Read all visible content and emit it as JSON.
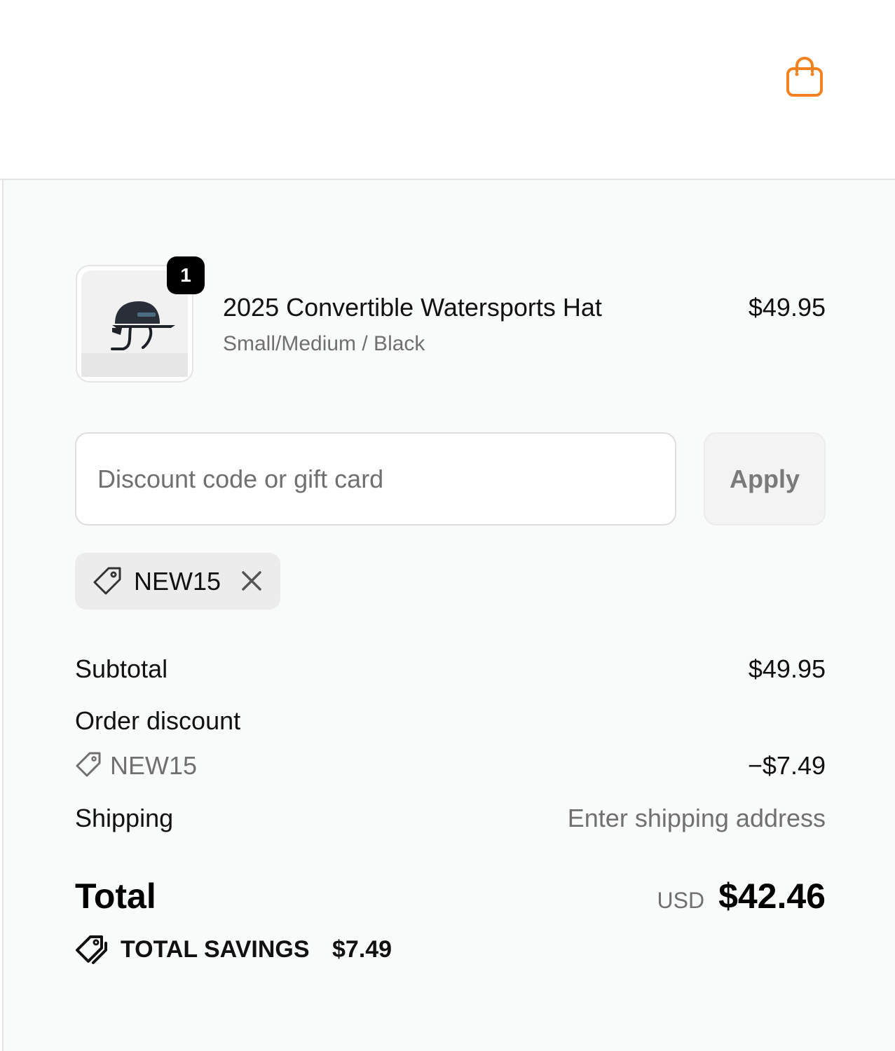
{
  "header": {
    "cart_icon": "shopping-bag-icon",
    "accent_color": "#f48120"
  },
  "product": {
    "image_alt": "hat-image",
    "quantity": "1",
    "name": "2025 Convertible Watersports Hat",
    "variant": "Small/Medium / Black",
    "price": "$49.95"
  },
  "discount": {
    "placeholder": "Discount code or gift card",
    "value": "",
    "apply_label": "Apply",
    "applied_code": "NEW15"
  },
  "summary": {
    "subtotal_label": "Subtotal",
    "subtotal_value": "$49.95",
    "order_discount_label": "Order discount",
    "discount_code": "NEW15",
    "discount_value": "−$7.49",
    "shipping_label": "Shipping",
    "shipping_value": "Enter shipping address",
    "total_label": "Total",
    "currency": "USD",
    "total_value": "$42.46",
    "savings_label": "TOTAL SAVINGS",
    "savings_value": "$7.49"
  }
}
